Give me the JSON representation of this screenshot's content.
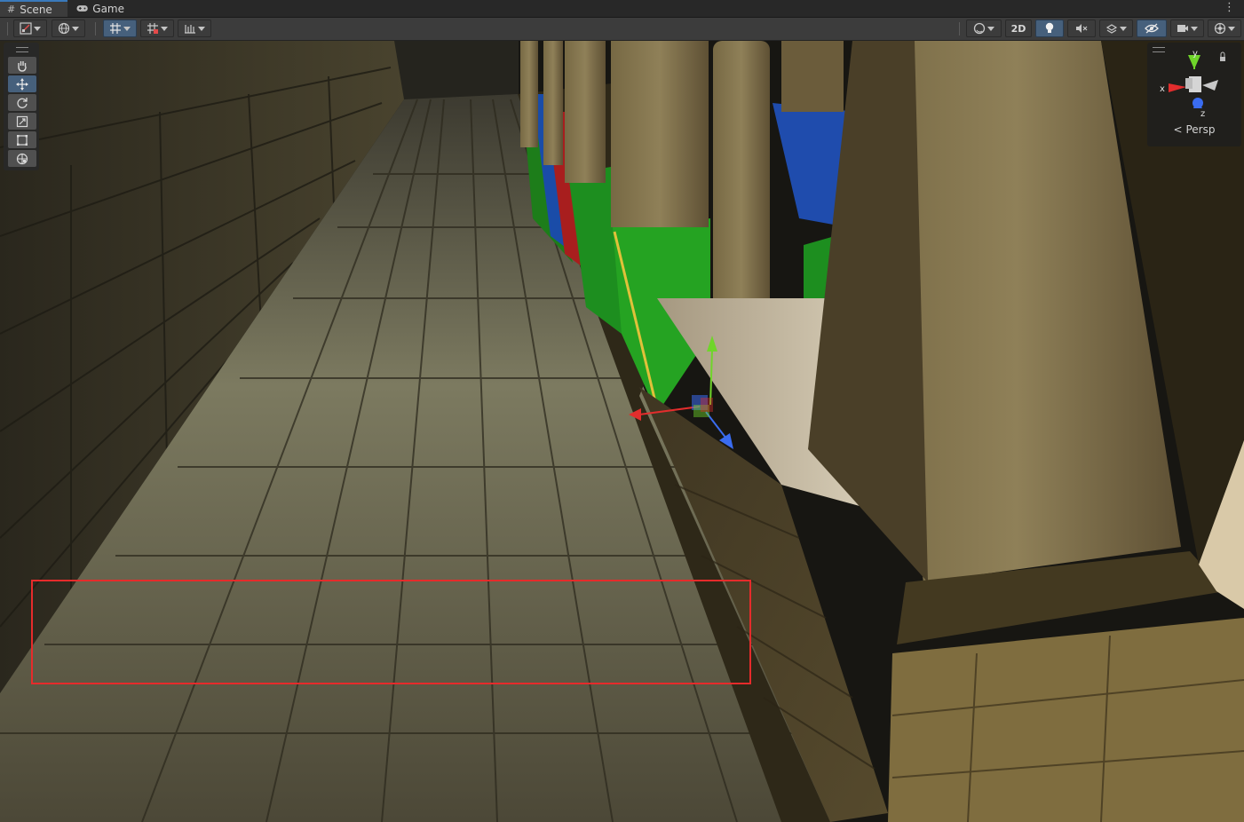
{
  "window": {
    "tabs": [
      {
        "label": "Scene",
        "icon": "grid-hash-icon",
        "active": true
      },
      {
        "label": "Game",
        "icon": "gamepad-icon",
        "active": false
      }
    ],
    "menu_icon": "kebab-menu-icon"
  },
  "toolbar": {
    "shading_2d_label": "2D"
  },
  "scene_gizmo": {
    "axis_x": "x",
    "axis_y": "y",
    "axis_z": "z",
    "projection_label": "Persp"
  },
  "colors": {
    "accent_blue": "#3a79bb",
    "toggle_on": "#46607c",
    "axis_x": "#e22d2d",
    "axis_y": "#6fd52a",
    "axis_z": "#3a6cf0",
    "highlight_box": "#e62b2b"
  }
}
